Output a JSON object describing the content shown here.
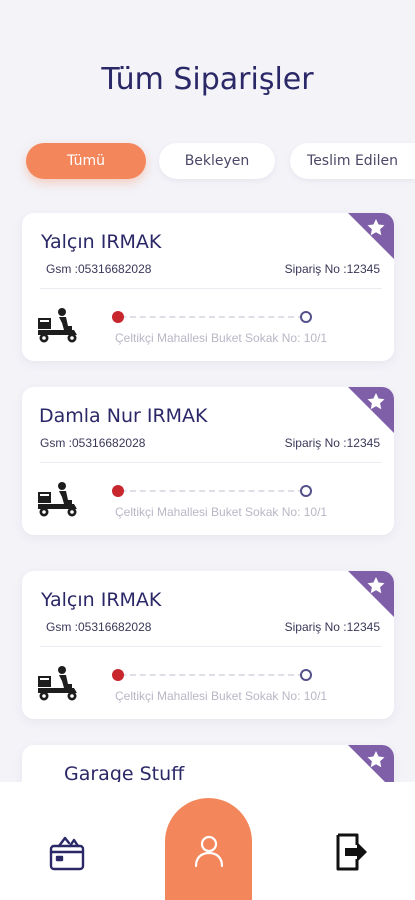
{
  "page": {
    "title": "Tüm Siparişler"
  },
  "tabs": [
    {
      "label": "Tümü",
      "active": true
    },
    {
      "label": "Bekleyen",
      "active": false
    },
    {
      "label": "Teslim Edilen",
      "active": false
    }
  ],
  "orders": [
    {
      "name": "Yalçın IRMAK",
      "gsm": "Gsm :05316682028",
      "order_no": "Sipariş No :12345",
      "address": "Çeltikçi Mahallesi Buket Sokak No: 10/1"
    },
    {
      "name": "Damla Nur IRMAK",
      "gsm": "Gsm :05316682028",
      "order_no": "Sipariş No :12345",
      "address": "Çeltikçi Mahallesi Buket Sokak No: 10/1"
    },
    {
      "name": "Yalçın IRMAK",
      "gsm": "Gsm :05316682028",
      "order_no": "Sipariş No :12345",
      "address": "Çeltikçi Mahallesi Buket Sokak No: 10/1"
    },
    {
      "name": "Garage Stuff"
    }
  ],
  "colors": {
    "accent": "#f3875b",
    "title": "#2b2867",
    "badge": "#7f5fa8",
    "route_start": "#c8262d",
    "route_end": "#54508a",
    "background": "#f3f3f8"
  },
  "icons": {
    "delivery": "delivery-scooter-icon",
    "favorite": "star-icon",
    "orders_nav": "shopping-bag-icon",
    "profile_nav": "user-icon",
    "logout_nav": "logout-icon"
  }
}
